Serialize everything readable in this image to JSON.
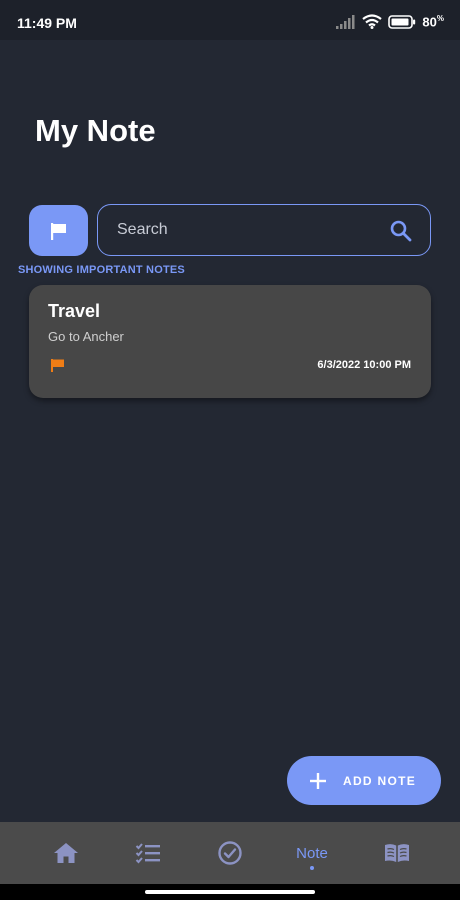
{
  "status_bar": {
    "time": "11:49 PM",
    "battery": "80",
    "battery_unit": "%"
  },
  "header": {
    "title": "My Note"
  },
  "search": {
    "placeholder": "Search"
  },
  "filter": {
    "label": "SHOWING IMPORTANT NOTES"
  },
  "notes": [
    {
      "title": "Travel",
      "body": "Go to Ancher",
      "date": "6/3/2022 10:00 PM",
      "important": true
    }
  ],
  "fab": {
    "label": "ADD NOTE"
  },
  "bottom_nav": {
    "items": [
      {
        "icon": "home-icon"
      },
      {
        "icon": "checklist-icon"
      },
      {
        "icon": "check-circle-icon"
      },
      {
        "label": "Note",
        "active": true
      },
      {
        "icon": "book-icon"
      }
    ]
  },
  "colors": {
    "accent": "#7a98f6",
    "background": "#232833",
    "card": "#474747",
    "flag": "#ef7d16",
    "nav_background": "#4b4b4b",
    "nav_icon": "#8c93c3"
  }
}
